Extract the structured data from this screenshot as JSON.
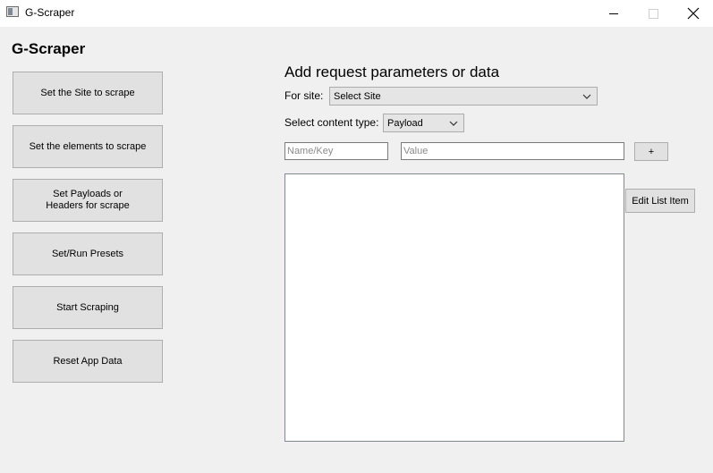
{
  "window": {
    "title": "G-Scraper",
    "icons": {
      "app": "app-window-icon",
      "minimize": "minimize-icon",
      "maximize": "maximize-icon",
      "close": "close-icon"
    }
  },
  "sidebar": {
    "heading": "G-Scraper",
    "buttons": [
      {
        "label": "Set the Site to scrape"
      },
      {
        "label": "Set the elements to scrape"
      },
      {
        "label": "Set Payloads or\nHeaders for scrape"
      },
      {
        "label": "Set/Run Presets"
      },
      {
        "label": "Start Scraping"
      },
      {
        "label": "Reset App Data"
      }
    ]
  },
  "main": {
    "title": "Add request parameters or data",
    "site_label": "For site:",
    "site_select": "Select Site",
    "content_type_label": "Select content type:",
    "content_type_select": "Payload",
    "name_placeholder": "Name/Key",
    "value_placeholder": "Value",
    "add_button": "+",
    "edit_button": "Edit List Item",
    "list_items": []
  }
}
